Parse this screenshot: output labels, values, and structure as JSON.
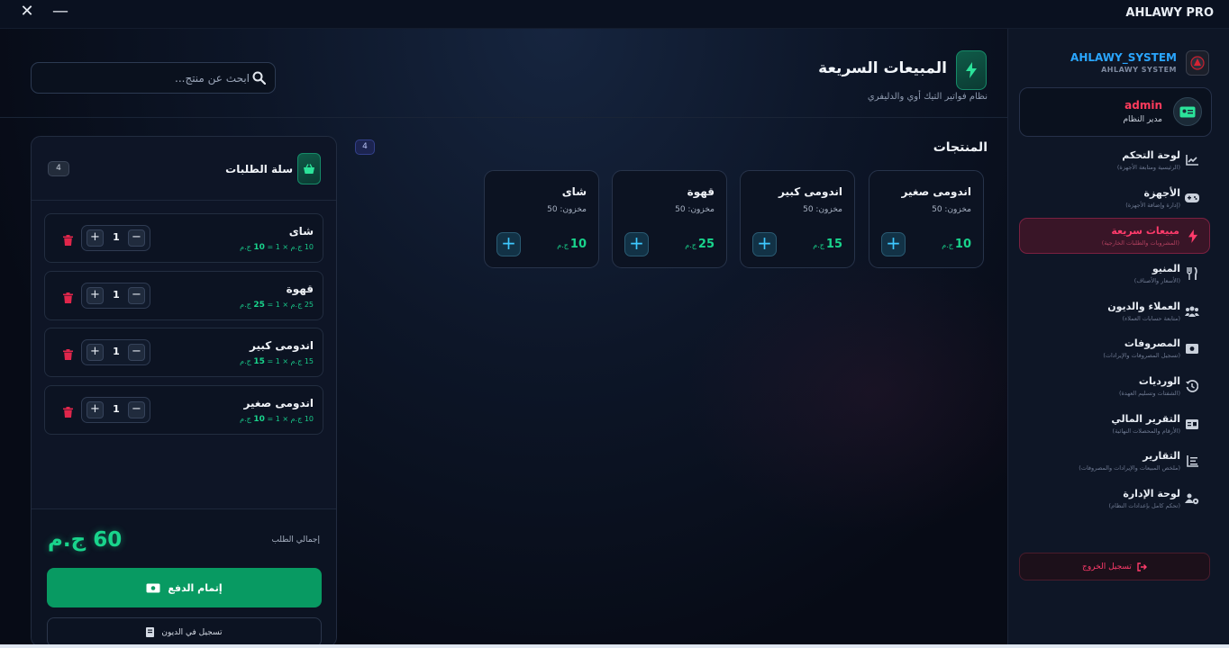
{
  "window": {
    "title": "AHLAWY PRO",
    "close_glyph": "✕",
    "minimize_glyph": "—"
  },
  "header": {
    "title": "المبيعات السريعة",
    "subtitle": "نظام فواتير التيك أوي والدليفري",
    "icon": "lightning-icon"
  },
  "search": {
    "placeholder": "ابحث عن منتج...",
    "icon": "search-icon"
  },
  "products": {
    "title": "المنتجات",
    "count": "4",
    "items": [
      {
        "name": "اندومى صغير",
        "stock": "مخزون: 50",
        "price": "10",
        "currency": "ج.م"
      },
      {
        "name": "اندومى كبير",
        "stock": "مخزون: 50",
        "price": "15",
        "currency": "ج.م"
      },
      {
        "name": "قهوة",
        "stock": "مخزون: 50",
        "price": "25",
        "currency": "ج.م"
      },
      {
        "name": "شاى",
        "stock": "مخزون: 50",
        "price": "10",
        "currency": "ج.م"
      }
    ]
  },
  "cart": {
    "title": "سلة الطلبات",
    "count": "4",
    "items": [
      {
        "name": "شاى",
        "calc_prefix": "10 ج.م × 1 = ",
        "subtotal": "10",
        "currency": "ج.م",
        "qty": "1"
      },
      {
        "name": "قهوة",
        "calc_prefix": "25 ج.م × 1 = ",
        "subtotal": "25",
        "currency": "ج.م",
        "qty": "1"
      },
      {
        "name": "اندومى كبير",
        "calc_prefix": "15 ج.م × 1 = ",
        "subtotal": "15",
        "currency": "ج.م",
        "qty": "1"
      },
      {
        "name": "اندومى صغير",
        "calc_prefix": "10 ج.م × 1 = ",
        "subtotal": "10",
        "currency": "ج.م",
        "qty": "1"
      }
    ],
    "total_label": "إجمالي الطلب",
    "total_value": "60 ج.م",
    "pay_label": "إتمام الدفع",
    "debt_label": "تسجيل في الديون"
  },
  "sidebar": {
    "brand_name": "AHLAWY_SYSTEM",
    "brand_sub": "AHLAWY SYSTEM",
    "user": {
      "name": "admin",
      "role": "مدير النظام"
    },
    "items": [
      {
        "label": "لوحة التحكم",
        "sub": "(الرئيسية ومتابعة الأجهزة)",
        "icon": "chart-line-icon",
        "active": false
      },
      {
        "label": "الأجهزة",
        "sub": "(إدارة وإضافة الأجهزة)",
        "icon": "gamepad-icon",
        "active": false
      },
      {
        "label": "مبيعات سريعة",
        "sub": "(المشروبات والطلبات الخارجية)",
        "icon": "lightning-icon",
        "active": true
      },
      {
        "label": "المنيو",
        "sub": "(الأسعار والأصناف)",
        "icon": "utensils-icon",
        "active": false
      },
      {
        "label": "العملاء والديون",
        "sub": "(متابعة حسابات العملاء)",
        "icon": "users-icon",
        "active": false
      },
      {
        "label": "المصروفات",
        "sub": "(تسجيل المصروفات والإيرادات)",
        "icon": "money-icon",
        "active": false
      },
      {
        "label": "الورديات",
        "sub": "(الشفتات وتسليم العهدة)",
        "icon": "history-icon",
        "active": false
      },
      {
        "label": "التقرير المالي",
        "sub": "(الأرقام والمحصلات النهائية)",
        "icon": "receipt-icon",
        "active": false
      },
      {
        "label": "التقارير",
        "sub": "(ملخص المبيعات والإيرادات والمصروفات)",
        "icon": "list-icon",
        "active": false
      },
      {
        "label": "لوحة الإدارة",
        "sub": "(تحكم كامل بإعدادات النظام)",
        "icon": "users-cog-icon",
        "active": false
      }
    ],
    "logout_label": "تسجيل الخروج"
  },
  "colors": {
    "accent_green": "#19d48c",
    "accent_red": "#ff3b6b",
    "accent_blue": "#2aa6ff",
    "pay_button": "#089a62"
  }
}
